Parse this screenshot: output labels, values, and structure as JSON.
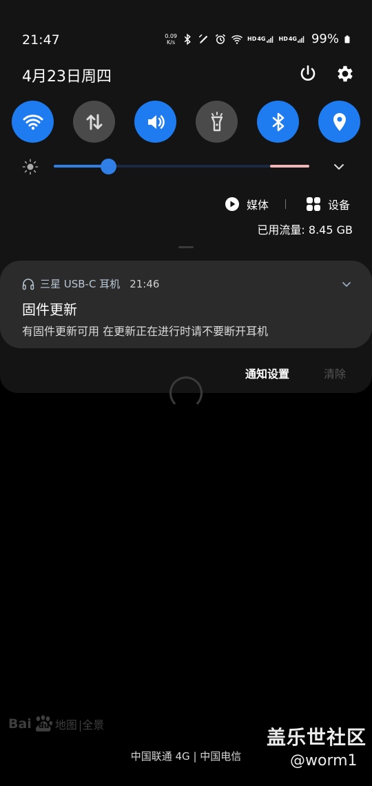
{
  "status_bar": {
    "time": "21:47",
    "net_speed_value": "0.09",
    "net_speed_unit": "K/s",
    "sim1_label": "HD",
    "sim1_net": "4G",
    "sim2_label": "HD",
    "sim2_net": "4G",
    "battery": "99%"
  },
  "header": {
    "date": "4月23日周四"
  },
  "quick_toggles": [
    {
      "name": "wifi",
      "state": "on"
    },
    {
      "name": "mobile-data",
      "state": "off"
    },
    {
      "name": "sound",
      "state": "on"
    },
    {
      "name": "flashlight",
      "state": "off"
    },
    {
      "name": "bluetooth",
      "state": "on"
    },
    {
      "name": "location",
      "state": "on"
    }
  ],
  "brightness": {
    "level": 0.22
  },
  "media": {
    "media_label": "媒体",
    "device_label": "设备"
  },
  "data_usage": "已用流量: 8.45 GB",
  "notification": {
    "app": "三星 USB-C 耳机",
    "time": "21:46",
    "title": "固件更新",
    "body": "有固件更新可用 在更新正在进行时请不要断开耳机"
  },
  "actions": {
    "notification_settings": "通知设置",
    "clear": "清除"
  },
  "watermarks": {
    "baidu_text": "Bai",
    "baidu_du": "du",
    "baidu_map": "地图",
    "baidu_pano": "|全景",
    "site": "盖乐世社区",
    "user": "@worm1"
  },
  "carrier": "中国联通 4G | 中国电信",
  "colors": {
    "accent": "#1e7cf0",
    "toggle_off": "#4a4a4a",
    "panel_bg": "#141414",
    "notification_bg": "#2b2b2b"
  }
}
